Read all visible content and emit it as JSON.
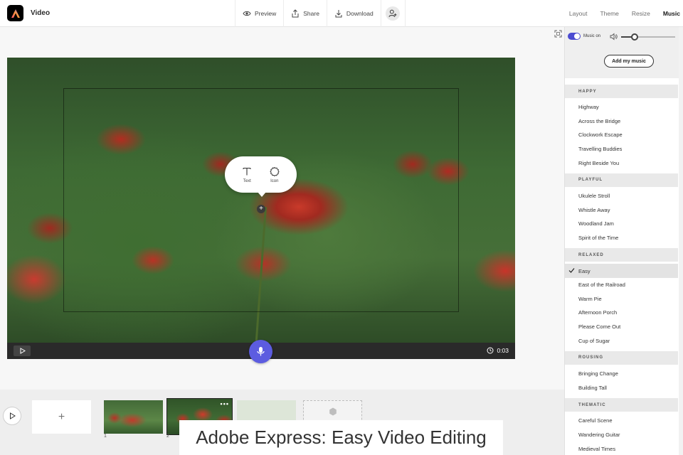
{
  "app": {
    "title": "Video"
  },
  "toolbar": {
    "preview_label": "Preview",
    "share_label": "Share",
    "download_label": "Download",
    "invite_icon": "add-person-icon"
  },
  "tabs": [
    {
      "label": "Layout",
      "active": false
    },
    {
      "label": "Theme",
      "active": false
    },
    {
      "label": "Resize",
      "active": false
    },
    {
      "label": "Music",
      "active": true
    }
  ],
  "canvas": {
    "popover": {
      "text_label": "Text",
      "icon_label": "Icon"
    }
  },
  "player": {
    "time": "0:03"
  },
  "timeline": {
    "add_label": "+",
    "scene_numbers": [
      "1",
      "2"
    ],
    "scene_more": "•••"
  },
  "caption": "Adobe Express: Easy Video Editing",
  "music_panel": {
    "toggle_label": "Music on",
    "toggle_on": true,
    "volume_level": 0.25,
    "add_music_label": "Add my music",
    "categories": [
      {
        "name": "HAPPY",
        "tracks": [
          "Highway",
          "Across the Bridge",
          "Clockwork Escape",
          "Travelling Buddies",
          "Right Beside You"
        ]
      },
      {
        "name": "PLAYFUL",
        "tracks": [
          "Ukulele Stroll",
          "Whistle Away",
          "Woodland Jam",
          "Spirit of the Time"
        ]
      },
      {
        "name": "RELAXED",
        "tracks": [
          "Easy",
          "East of the Railroad",
          "Warm Pie",
          "Afternoon Porch",
          "Please Come Out",
          "Cup of Sugar"
        ]
      },
      {
        "name": "ROUSING",
        "tracks": [
          "Bringing Change",
          "Building Tall"
        ]
      },
      {
        "name": "THEMATIC",
        "tracks": [
          "Careful Scene",
          "Wandering Guitar",
          "Medieval Times"
        ]
      }
    ],
    "selected_track": "Easy"
  },
  "colors": {
    "accent": "#5c5ce0",
    "toggle": "#4b4bd1",
    "player_bar": "#2a2a2a"
  }
}
